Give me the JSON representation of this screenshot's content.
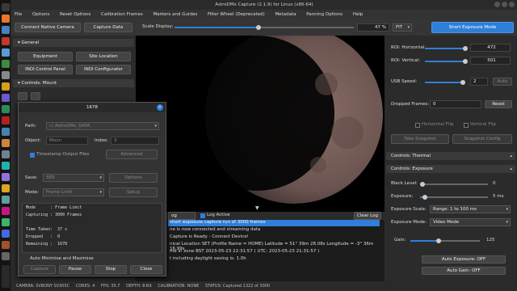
{
  "window": {
    "title": "AstroDMx Capture (2.1.9) for Linux (x86-64)"
  },
  "menu": [
    "File",
    "Options",
    "Reset Options",
    "Calibration Frames",
    "Markers and Guides",
    "Filter Wheel (Deprecated)",
    "Metadata",
    "Panning Options",
    "Help"
  ],
  "toolbar": {
    "connect": "Connect Native Camera",
    "capture": "Capture Data",
    "scale_label": "Scale Display:",
    "scale_value": "47 %",
    "scale_fraction": 0.47,
    "fit": "FIT",
    "short_exp": "Short Exposure Mode"
  },
  "left": {
    "general": "General",
    "equipment": "Equipment",
    "site": "Site Location",
    "indi_panel": "INDI Control Panel",
    "indi_config": "INDI Configurator",
    "mount": "Controls: Mount"
  },
  "dialog": {
    "title": "1678",
    "path_label": "Path:",
    "path_value": "AstroDMx_DATA",
    "object_label": "Object:",
    "object_value": "Moon",
    "index_label": "Index:",
    "index_value": "3",
    "timestamp": "Timestamp Output Files",
    "advanced": "Advanced",
    "save_label": "Save:",
    "save_value": "SER",
    "options": "Options",
    "mode_label": "Mode:",
    "mode_value": "Frame Limit",
    "setup": "Setup",
    "status_lines": [
      "Mode      : Frame Limit",
      "Capturing : 3000 Frames",
      "",
      "Time Taken:  37 s",
      "Dropped   :  0",
      "Remaining :  1678"
    ],
    "auto_minimise": "Auto Minimise and Maximise",
    "capture_btn": "Capture",
    "pause_btn": "Pause",
    "stop_btn": "Stop",
    "close_btn": "Close"
  },
  "log": {
    "combo": "og",
    "log_active": "Log Active",
    "clear": "Clear Log",
    "lines": [
      "short exposure capture run of 3000 frames",
      "ne is now connected and streaming data",
      "Capture is Ready - Connect Device!",
      "nical Location SET (Profile Name = HOME) Latitude = 51° 39m 28.08s Longitude = -3° 36m 16.99s",
      "me in zone BST 2023-05-23 22:31:57 ( UTC: 2023-05-23 21:31:57 )",
      "t including daylight saving is: 1.0h"
    ]
  },
  "right": {
    "roi_h_label": "ROI: Horizontal:",
    "roi_h": "472",
    "roi_v_label": "ROI: Vertical:",
    "roi_v": "501",
    "usb_label": "USB Speed:",
    "usb": "2",
    "auto": "Auto",
    "dropped_label": "Dropped Frames:",
    "dropped": "0",
    "reset": "Reset",
    "hflip": "Horizontal Flip",
    "vflip": "Vertical Flip",
    "snapshot": "Take Snapshot",
    "snapcfg": "Snapshot Config",
    "thermal": "Controls: Thermal",
    "exposure_sect": "Controls: Exposure",
    "black_label": "Black Level:",
    "black": "0",
    "exp_label": "Exposure:",
    "exp": "5 ms",
    "scale_label": "Exposure Scale:",
    "scale": "Range: 1 to 100 ms",
    "mode_label": "Exposure Mode:",
    "mode": "Video Mode",
    "gain_label": "Gain:",
    "gain": "125",
    "auto_exp": "Auto Exposure: OFF",
    "auto_gain": "Auto Gain: OFF"
  },
  "status": {
    "camera": "CAMERA: SVBONY SV305C",
    "cores": "CORES: 4",
    "fps": "FPS: 35.7",
    "depth": "DEPTH: 8-Bit",
    "calib": "CALIBRATION: NONE",
    "captured": "STATUS: Captured 1322 of 3000"
  }
}
